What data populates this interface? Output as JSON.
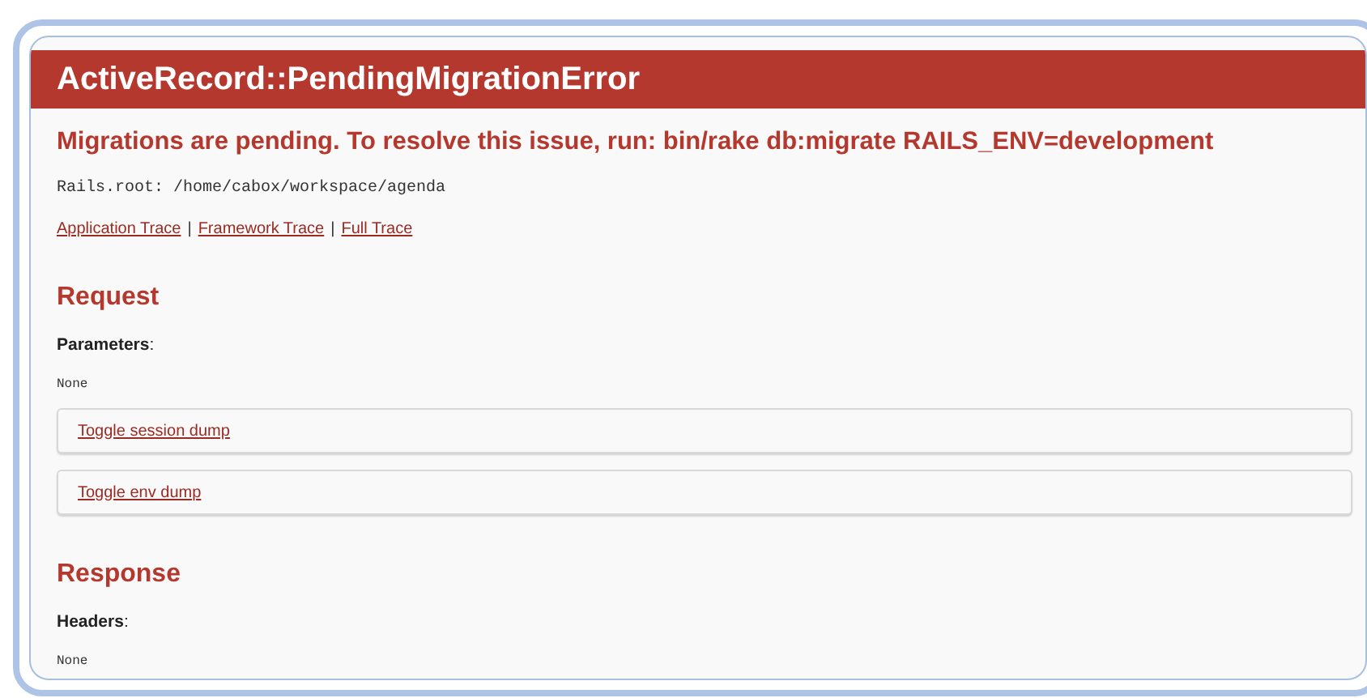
{
  "header": {
    "title": "ActiveRecord::PendingMigrationError"
  },
  "message": "Migrations are pending. To resolve this issue, run: bin/rake db:migrate RAILS_ENV=development",
  "rails_root": "Rails.root: /home/cabox/workspace/agenda",
  "trace_links": {
    "separator": "|",
    "links": [
      "Application Trace",
      "Framework Trace",
      "Full Trace"
    ]
  },
  "sections": [
    {
      "title": "Request",
      "label": "Parameters",
      "colon": ":",
      "value": "None",
      "toggles": [
        "Toggle session dump",
        "Toggle env dump"
      ]
    },
    {
      "title": "Response",
      "label": "Headers",
      "colon": ":",
      "value": "None"
    }
  ]
}
